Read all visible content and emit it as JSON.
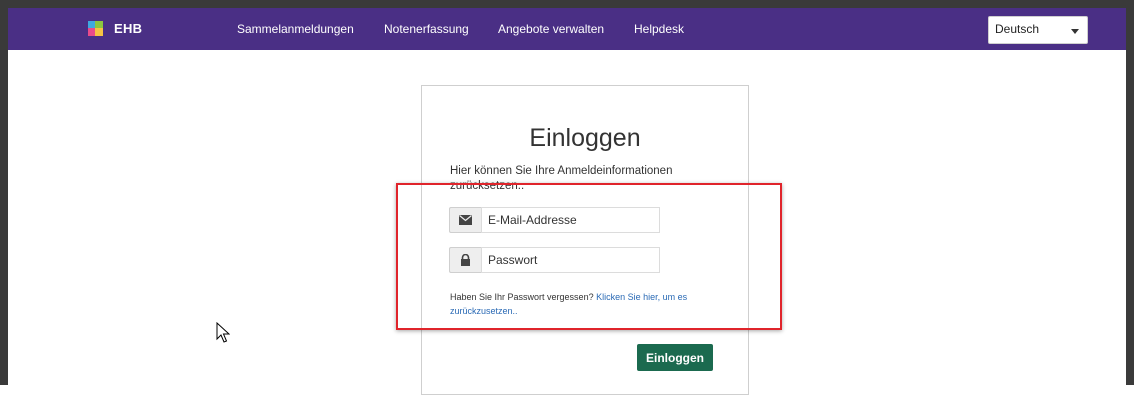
{
  "navbar": {
    "brand": "EHB",
    "links": [
      {
        "label": "Sammelanmeldungen"
      },
      {
        "label": "Notenerfassung"
      },
      {
        "label": "Angebote verwalten"
      },
      {
        "label": "Helpdesk"
      }
    ],
    "language": {
      "selected": "Deutsch",
      "icon": "chevron-down-icon"
    }
  },
  "login": {
    "title": "Einloggen",
    "description": "Hier können Sie Ihre Anmeldeinformationen zurücksetzen..",
    "email": {
      "placeholder": "E-Mail-Addresse",
      "icon": "envelope-icon"
    },
    "password": {
      "placeholder": "Passwort",
      "icon": "lock-icon"
    },
    "forgot_text": "Haben Sie Ihr Passwort vergessen?",
    "forgot_link": "Klicken Sie hier, um es zurückzusetzen..",
    "submit_label": "Einloggen"
  },
  "colors": {
    "navbar": "#4a2f85",
    "button": "#1b6a4f",
    "link": "#2a6ab5",
    "highlight": "#e0242b"
  }
}
